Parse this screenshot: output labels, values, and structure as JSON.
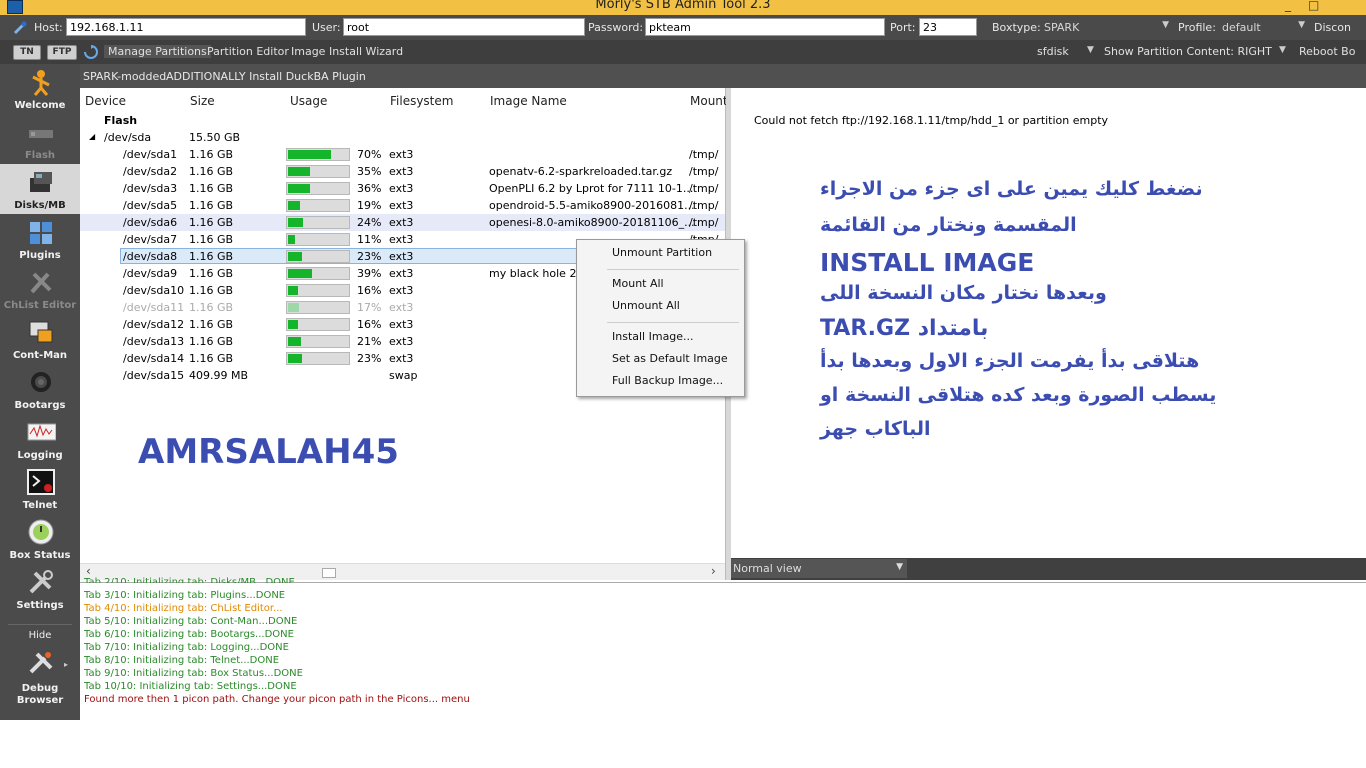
{
  "window": {
    "title": "Morly's STB Admin Tool 2.3",
    "minimize_label": "_",
    "maximize_label": "□"
  },
  "connection": {
    "host_label": "Host:",
    "host_value": "192.168.1.11",
    "user_label": "User:",
    "user_value": "root",
    "password_label": "Password:",
    "password_value": "pkteam",
    "port_label": "Port:",
    "port_value": "23",
    "boxtype_label": "Boxtype:",
    "boxtype_value": "SPARK",
    "profile_label": "Profile:",
    "profile_value": "default",
    "disconnect_label": "Discon"
  },
  "tabbar": {
    "tn_label": "TN",
    "ftp_label": "FTP",
    "tabs": [
      "Manage Partitions",
      "Partition Editor",
      "Image Install Wizard"
    ],
    "active_tab": "Manage Partitions",
    "sfdisk_label": "sfdisk",
    "show_partition_label": "Show Partition Content: RIGHT",
    "reboot_label": "Reboot Bo"
  },
  "subbar": {
    "items": [
      "SPARK-modded",
      "ADDITIONALLY Install DuckBA Plugin"
    ]
  },
  "sidebar": {
    "items": [
      {
        "label": "Welcome",
        "icon": "welcome-icon"
      },
      {
        "label": "Flash",
        "icon": "flash-icon"
      },
      {
        "label": "Disks/MB",
        "icon": "disks-icon"
      },
      {
        "label": "Plugins",
        "icon": "plugins-icon"
      },
      {
        "label": "ChList Editor",
        "icon": "chlist-editor-icon"
      },
      {
        "label": "Cont-Man",
        "icon": "cont-man-icon"
      },
      {
        "label": "Bootargs",
        "icon": "bootargs-icon"
      },
      {
        "label": "Logging",
        "icon": "logging-icon"
      },
      {
        "label": "Telnet",
        "icon": "telnet-icon"
      },
      {
        "label": "Box Status",
        "icon": "box-status-icon"
      },
      {
        "label": "Settings",
        "icon": "settings-icon"
      }
    ],
    "hide_label": "Hide",
    "debug_label_1": "Debug",
    "debug_label_2": "Browser"
  },
  "partitions": {
    "columns": [
      "Device",
      "Size",
      "Usage",
      "Filesystem",
      "Image Name",
      "Mount"
    ],
    "group_label": "Flash",
    "disk": {
      "device": "/dev/sda",
      "size": "15.50 GB",
      "expander": "◢"
    },
    "rows": [
      {
        "device": "/dev/sda1",
        "size": "1.16 GB",
        "usage": 70,
        "usage_text": "70%",
        "fs": "ext3",
        "image": "",
        "mount": "/tmp/"
      },
      {
        "device": "/dev/sda2",
        "size": "1.16 GB",
        "usage": 35,
        "usage_text": "35%",
        "fs": "ext3",
        "image": "openatv-6.2-sparkreloaded.tar.gz",
        "mount": "/tmp/"
      },
      {
        "device": "/dev/sda3",
        "size": "1.16 GB",
        "usage": 36,
        "usage_text": "36%",
        "fs": "ext3",
        "image": "OpenPLI 6.2 by Lprot for 7111 10-1...",
        "mount": "/tmp/"
      },
      {
        "device": "/dev/sda5",
        "size": "1.16 GB",
        "usage": 19,
        "usage_text": "19%",
        "fs": "ext3",
        "image": "opendroid-5.5-amiko8900-2016081...",
        "mount": "/tmp/"
      },
      {
        "device": "/dev/sda6",
        "size": "1.16 GB",
        "usage": 24,
        "usage_text": "24%",
        "fs": "ext3",
        "image": "openesi-8.0-amiko8900-20181106_...",
        "mount": "/tmp/"
      },
      {
        "device": "/dev/sda7",
        "size": "1.16 GB",
        "usage": 11,
        "usage_text": "11%",
        "fs": "ext3",
        "image": "",
        "mount": "/tmp/"
      },
      {
        "device": "/dev/sda8",
        "size": "1.16 GB",
        "usage": 23,
        "usage_text": "23%",
        "fs": "ext3",
        "image": "",
        "mount": ""
      },
      {
        "device": "/dev/sda9",
        "size": "1.16 GB",
        "usage": 39,
        "usage_text": "39%",
        "fs": "ext3",
        "image": "my black hole 2-",
        "mount": ""
      },
      {
        "device": "/dev/sda10",
        "size": "1.16 GB",
        "usage": 16,
        "usage_text": "16%",
        "fs": "ext3",
        "image": "",
        "mount": ""
      },
      {
        "device": "/dev/sda11",
        "size": "1.16 GB",
        "usage": 17,
        "usage_text": "17%",
        "fs": "ext3",
        "image": "",
        "mount": ""
      },
      {
        "device": "/dev/sda12",
        "size": "1.16 GB",
        "usage": 16,
        "usage_text": "16%",
        "fs": "ext3",
        "image": "",
        "mount": ""
      },
      {
        "device": "/dev/sda13",
        "size": "1.16 GB",
        "usage": 21,
        "usage_text": "21%",
        "fs": "ext3",
        "image": "",
        "mount": ""
      },
      {
        "device": "/dev/sda14",
        "size": "1.16 GB",
        "usage": 23,
        "usage_text": "23%",
        "fs": "ext3",
        "image": "",
        "mount": ""
      },
      {
        "device": "/dev/sda15",
        "size": "409.99 MB",
        "usage": null,
        "usage_text": "",
        "fs": "swap",
        "image": "",
        "mount": ""
      }
    ]
  },
  "context_menu": {
    "items": [
      "Unmount Partition",
      "Mount All",
      "Unmount All",
      "Install Image...",
      "Set as Default Image",
      "Full Backup Image..."
    ]
  },
  "right_panel": {
    "message": "Could not fetch ftp://192.168.1.11/tmp/hdd_1 or partition empty",
    "view_select": "Normal view"
  },
  "log": {
    "lines": [
      {
        "text": "Tab 3/10: Initializing tab: Plugins...DONE",
        "color": "#2a8a2a"
      },
      {
        "text": "Tab 4/10: Initializing tab: ChList Editor...",
        "color": "#e08a00"
      },
      {
        "text": "Tab 5/10: Initializing tab: Cont-Man...DONE",
        "color": "#2a8a2a"
      },
      {
        "text": "Tab 6/10: Initializing tab: Bootargs...DONE",
        "color": "#2a8a2a"
      },
      {
        "text": "Tab 7/10: Initializing tab: Logging...DONE",
        "color": "#2a8a2a"
      },
      {
        "text": "Tab 8/10: Initializing tab: Telnet...DONE",
        "color": "#2a8a2a"
      },
      {
        "text": "Tab 9/10: Initializing tab: Box Status...DONE",
        "color": "#2a8a2a"
      },
      {
        "text": "Tab 10/10: Initializing tab: Settings...DONE",
        "color": "#2a8a2a"
      },
      {
        "text": "Found more then 1 picon path. Change your picon path in the Picons... menu",
        "color": "#a01010"
      }
    ]
  },
  "overlay": {
    "watermark": "AMRSALAH45",
    "instructions": [
      "نضغط كليك يمين على اى جزء من الاجزاء",
      "المقسمة ونختار من القائمة",
      "INSTALL IMAGE",
      "وبعدها نختار مكان النسخة اللى",
      "بامتداد TAR.GZ",
      "هتلاقى بدأ يفرمت الجزء الاول وبعدها بدأ",
      "يسطب الصورة وبعد كده هتلاقى النسخة او",
      "الباكاب جهز"
    ]
  },
  "colors": {
    "usage_fill": "#14b52a",
    "titlebar": "#f2c144",
    "overlay_text": "#3c4db2"
  }
}
